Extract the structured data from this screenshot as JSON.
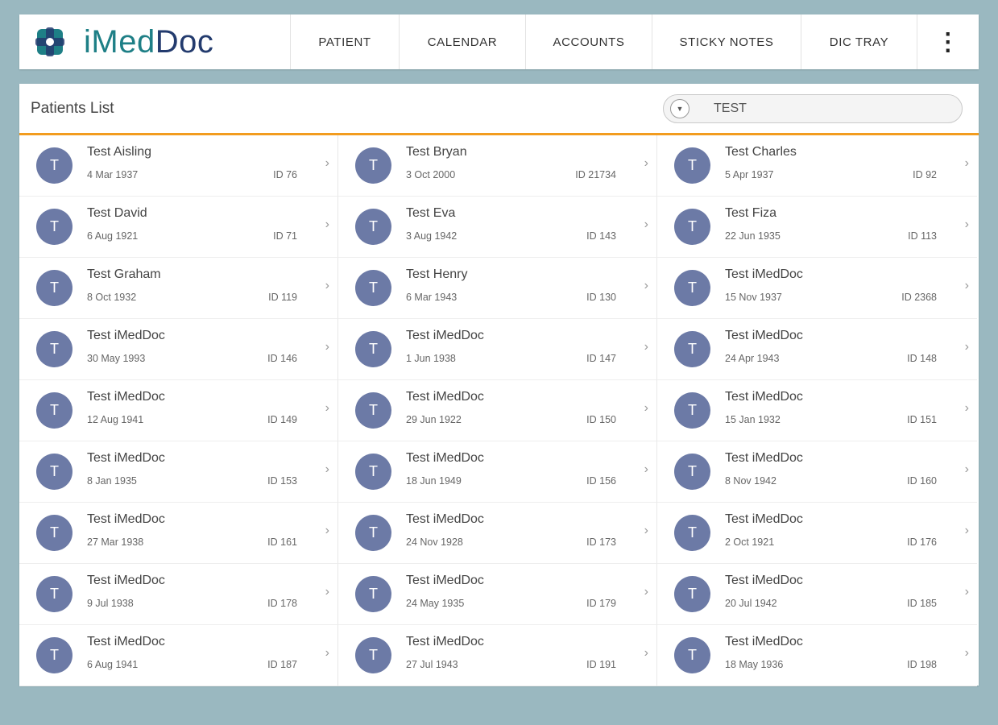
{
  "app": {
    "logo_part1": "iMed",
    "logo_part2": "Doc",
    "nav": [
      "PATIENT",
      "CALENDAR",
      "ACCOUNTS",
      "STICKY NOTES",
      "DIC TRAY"
    ],
    "more_label": "⋮"
  },
  "panel": {
    "title": "Patients List",
    "search_value": "TEST"
  },
  "colors": {
    "accent": "#f29c1f",
    "brand_teal": "#1e7f86",
    "brand_navy": "#233b6e",
    "avatar": "#6c7aa6",
    "background": "#9ab8c0"
  },
  "patients": [
    {
      "initial": "T",
      "name": "Test Aisling",
      "dob": "4 Mar 1937",
      "id": "ID 76"
    },
    {
      "initial": "T",
      "name": "Test Bryan",
      "dob": "3 Oct 2000",
      "id": "ID 21734"
    },
    {
      "initial": "T",
      "name": "Test Charles",
      "dob": "5 Apr 1937",
      "id": "ID 92"
    },
    {
      "initial": "T",
      "name": "Test David",
      "dob": "6 Aug 1921",
      "id": "ID 71"
    },
    {
      "initial": "T",
      "name": "Test Eva",
      "dob": "3 Aug 1942",
      "id": "ID 143"
    },
    {
      "initial": "T",
      "name": "Test Fiza",
      "dob": "22 Jun 1935",
      "id": "ID 113"
    },
    {
      "initial": "T",
      "name": "Test Graham",
      "dob": "8 Oct 1932",
      "id": "ID 119"
    },
    {
      "initial": "T",
      "name": "Test Henry",
      "dob": "6 Mar 1943",
      "id": "ID 130"
    },
    {
      "initial": "T",
      "name": "Test iMedDoc",
      "dob": "15 Nov 1937",
      "id": "ID 2368"
    },
    {
      "initial": "T",
      "name": "Test iMedDoc",
      "dob": "30 May 1993",
      "id": "ID 146"
    },
    {
      "initial": "T",
      "name": "Test iMedDoc",
      "dob": "1 Jun 1938",
      "id": "ID 147"
    },
    {
      "initial": "T",
      "name": "Test iMedDoc",
      "dob": "24 Apr 1943",
      "id": "ID 148"
    },
    {
      "initial": "T",
      "name": "Test iMedDoc",
      "dob": "12 Aug 1941",
      "id": "ID 149"
    },
    {
      "initial": "T",
      "name": "Test iMedDoc",
      "dob": "29 Jun 1922",
      "id": "ID 150"
    },
    {
      "initial": "T",
      "name": "Test iMedDoc",
      "dob": "15 Jan 1932",
      "id": "ID 151"
    },
    {
      "initial": "T",
      "name": "Test iMedDoc",
      "dob": "8 Jan 1935",
      "id": "ID 153"
    },
    {
      "initial": "T",
      "name": "Test iMedDoc",
      "dob": "18 Jun 1949",
      "id": "ID 156"
    },
    {
      "initial": "T",
      "name": "Test iMedDoc",
      "dob": "8 Nov 1942",
      "id": "ID 160"
    },
    {
      "initial": "T",
      "name": "Test iMedDoc",
      "dob": "27 Mar 1938",
      "id": "ID 161"
    },
    {
      "initial": "T",
      "name": "Test iMedDoc",
      "dob": "24 Nov 1928",
      "id": "ID 173"
    },
    {
      "initial": "T",
      "name": "Test iMedDoc",
      "dob": "2 Oct 1921",
      "id": "ID 176"
    },
    {
      "initial": "T",
      "name": "Test iMedDoc",
      "dob": "9 Jul 1938",
      "id": "ID 178"
    },
    {
      "initial": "T",
      "name": "Test iMedDoc",
      "dob": "24 May 1935",
      "id": "ID 179"
    },
    {
      "initial": "T",
      "name": "Test iMedDoc",
      "dob": "20 Jul 1942",
      "id": "ID 185"
    },
    {
      "initial": "T",
      "name": "Test iMedDoc",
      "dob": "6 Aug 1941",
      "id": "ID 187"
    },
    {
      "initial": "T",
      "name": "Test iMedDoc",
      "dob": "27 Jul 1943",
      "id": "ID 191"
    },
    {
      "initial": "T",
      "name": "Test iMedDoc",
      "dob": "18 May 1936",
      "id": "ID 198"
    }
  ]
}
